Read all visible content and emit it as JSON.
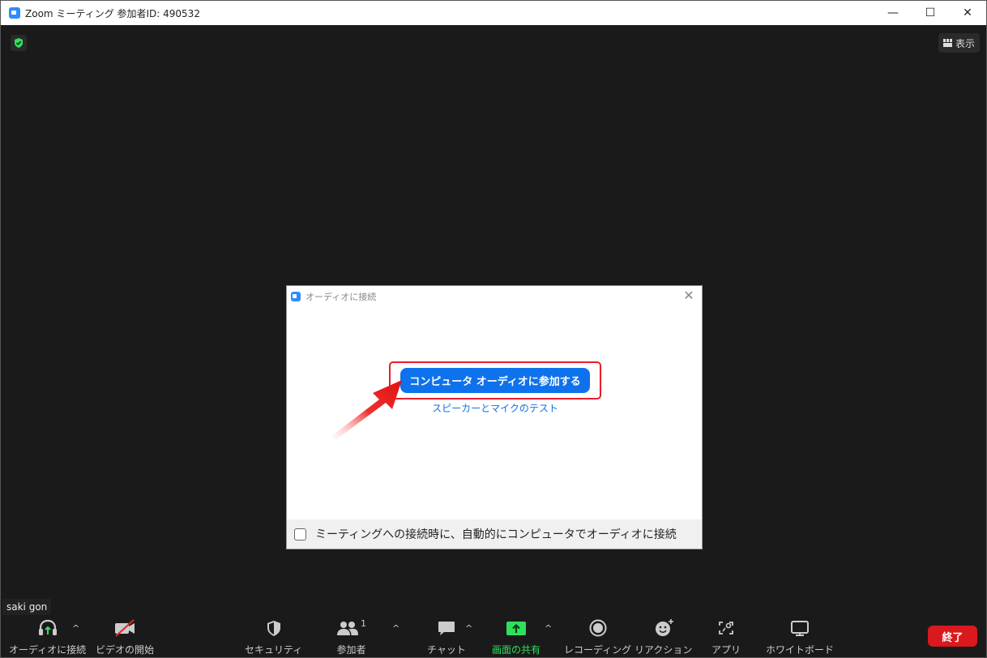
{
  "window": {
    "title": "Zoom ミーティング 参加者ID: 490532",
    "minimize_glyph": "—",
    "maximize_glyph": "☐",
    "close_glyph": "✕"
  },
  "view": {
    "display_label": "表示"
  },
  "dialog": {
    "title": "オーディオに接続",
    "close_glyph": "✕",
    "join_button": "コンピュータ オーディオに参加する",
    "test_link": "スピーカーとマイクのテスト",
    "auto_connect_label": "ミーティングへの接続時に、自動的にコンピュータでオーディオに接続",
    "auto_connect_checked": false
  },
  "participant": {
    "name": "saki gon"
  },
  "toolbar": {
    "audio": "オーディオに接続",
    "video": "ビデオの開始",
    "security": "セキュリティ",
    "participants": "参加者",
    "participants_count": "1",
    "chat": "チャット",
    "share": "画面の共有",
    "record": "レコーディング",
    "reactions": "リアクション",
    "apps": "アプリ",
    "whiteboard": "ホワイトボード",
    "end": "終了",
    "caret": "^"
  },
  "icons": {
    "shield": "shield-check-icon",
    "display": "grid-icon",
    "audio": "headphones-icon",
    "video": "video-off-icon",
    "security": "shield-icon",
    "participants": "people-icon",
    "chat": "chat-bubble-icon",
    "share": "share-screen-icon",
    "record": "record-icon",
    "reactions": "emoji-plus-icon",
    "apps": "apps-icon",
    "whiteboard": "whiteboard-icon"
  },
  "colors": {
    "accent_blue": "#0e72ed",
    "highlight_red": "#e81c2c",
    "share_green": "#2ee05d",
    "end_red": "#d9191d",
    "background": "#1a1a1a"
  }
}
